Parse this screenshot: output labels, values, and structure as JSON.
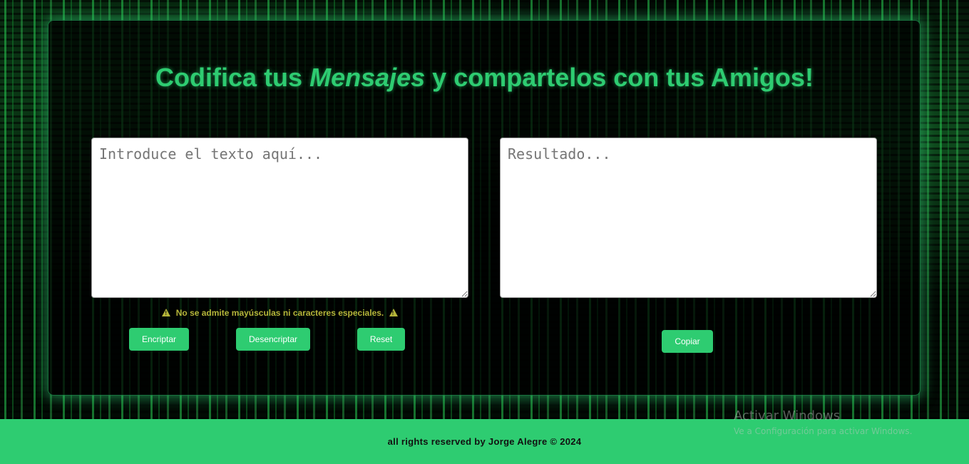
{
  "header": {
    "title_before": "Codifica tus ",
    "title_emphasis": "Mensajes",
    "title_after": " y compartelos con tus Amigos!"
  },
  "input": {
    "value": "",
    "placeholder": "Introduce el texto aquí..."
  },
  "output": {
    "value": "",
    "placeholder": "Resultado..."
  },
  "warning": {
    "text": "No se admite mayúsculas ni caracteres especiales."
  },
  "actions": {
    "encrypt_label": "Encriptar",
    "decrypt_label": "Desencriptar",
    "reset_label": "Reset",
    "copy_label": "Copiar"
  },
  "footer": {
    "text": "all rights reserved by Jorge Alegre © 2024"
  },
  "os_watermark": {
    "title": "Activar Windows",
    "subtitle": "Ve a Configuración para activar Windows."
  },
  "colors": {
    "accent": "#2ecc71",
    "warning": "#b5b53a",
    "background": "#020a04"
  }
}
